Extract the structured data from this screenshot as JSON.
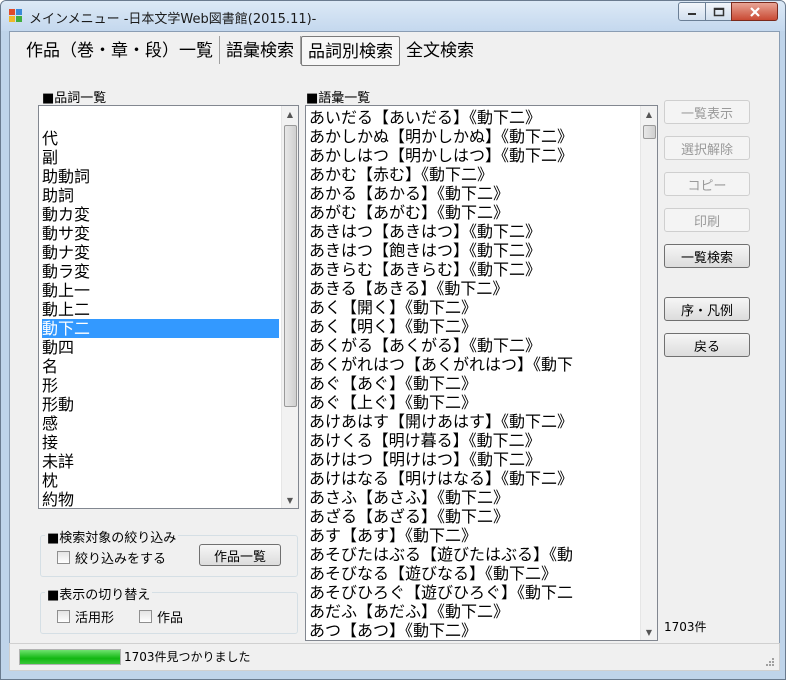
{
  "window": {
    "title": "メインメニュー -日本文学Web図書館(2015.11)-"
  },
  "tabs": [
    "作品（巻・章・段）一覧",
    "語彙検索",
    "品詞別検索",
    "全文検索"
  ],
  "pos_list": {
    "label": "■品詞一覧",
    "items": [
      "",
      "代",
      "副",
      "助動詞",
      "助詞",
      "動カ変",
      "動サ変",
      "動ナ変",
      "動ラ変",
      "動上一",
      "動上二",
      "動下二",
      "動四",
      "名",
      "形",
      "形動",
      "感",
      "接",
      "未詳",
      "枕",
      "約物"
    ],
    "selected": "動下二"
  },
  "vocab_list": {
    "label": "■語彙一覧",
    "items": [
      "あいだる【あいだる】《動下二》",
      "あかしかぬ【明かしかぬ】《動下二》",
      "あかしはつ【明かしはつ】《動下二》",
      "あかむ【赤む】《動下二》",
      "あかる【あかる】《動下二》",
      "あがむ【あがむ】《動下二》",
      "あきはつ【あきはつ】《動下二》",
      "あきはつ【飽きはつ】《動下二》",
      "あきらむ【あきらむ】《動下二》",
      "あきる【あきる】《動下二》",
      "あく【開く】《動下二》",
      "あく【明く】《動下二》",
      "あくがる【あくがる】《動下二》",
      "あくがれはつ【あくがれはつ】《動下",
      "あぐ【あぐ】《動下二》",
      "あぐ【上ぐ】《動下二》",
      "あけあはす【開けあはす】《動下二》",
      "あけくる【明け暮る】《動下二》",
      "あけはつ【明けはつ】《動下二》",
      "あけはなる【明けはなる】《動下二》",
      "あさふ【あさふ】《動下二》",
      "あざる【あざる】《動下二》",
      "あす【あす】《動下二》",
      "あそびたはぶる【遊びたはぶる】《動",
      "あそびなる【遊びなる】《動下二》",
      "あそびひろぐ【遊びひろぐ】《動下二",
      "あだふ【あだふ】《動下二》",
      "あつ【あつ】《動下二》"
    ]
  },
  "buttons": {
    "list_display": "一覧表示",
    "clear_selection": "選択解除",
    "copy": "コピー",
    "print": "印刷",
    "list_search": "一覧検索",
    "preface": "序・凡例",
    "back": "戻る",
    "works_list": "作品一覧"
  },
  "filter_group": {
    "title": "■検索対象の絞り込み",
    "checkbox": "絞り込みをする",
    "checked": false
  },
  "display_group": {
    "title": "■表示の切り替え",
    "conjugation": "活用形",
    "work": "作品"
  },
  "count": "1703件",
  "status": {
    "text": "1703件見つかりました",
    "progress": 1.0
  },
  "colors": {
    "selection": "#3399ff",
    "progress": "#12b712"
  }
}
